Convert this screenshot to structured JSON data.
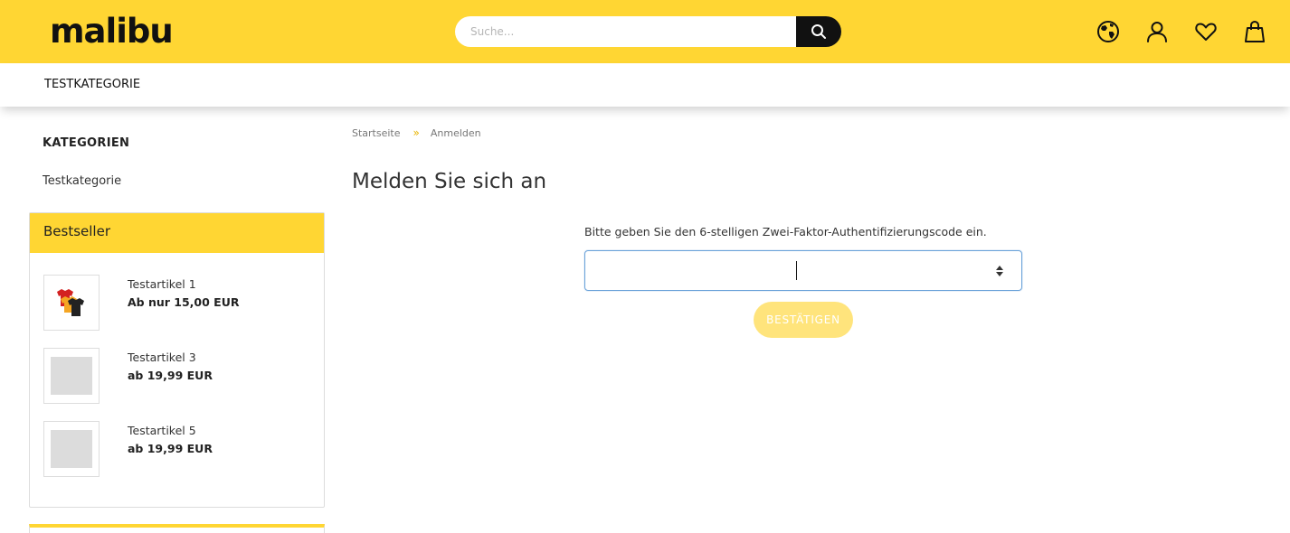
{
  "header": {
    "logo": "malibu",
    "search": {
      "placeholder": "Suche..."
    },
    "icons": [
      "globe-icon",
      "user-icon",
      "heart-icon",
      "bag-icon"
    ]
  },
  "nav": {
    "items": [
      {
        "label": "TESTKATEGORIE"
      }
    ]
  },
  "sidebar": {
    "categories_title": "KATEGORIEN",
    "categories": [
      {
        "label": "Testkategorie"
      }
    ],
    "bestseller": {
      "title": "Bestseller",
      "items": [
        {
          "name": "Testartikel 1",
          "price": "Ab nur 15,00 EUR",
          "image": "tshirts"
        },
        {
          "name": "Testartikel 3",
          "price": "ab 19,99 EUR",
          "image": "placeholder"
        },
        {
          "name": "Testartikel 5",
          "price": "ab 19,99 EUR",
          "image": "placeholder"
        }
      ]
    }
  },
  "main": {
    "breadcrumb": [
      "Startseite",
      "Anmelden"
    ],
    "breadcrumb_separator": "»",
    "title": "Melden Sie sich an",
    "instruction": "Bitte geben Sie den 6-stelligen Zwei-Faktor-Authentifizierungscode ein.",
    "code_value": "",
    "submit_label": "BESTÄTIGEN"
  },
  "colors": {
    "brand_yellow": "#ffd633",
    "button_disabled": "#ffe47c",
    "focus_border": "#6aa2d9"
  }
}
